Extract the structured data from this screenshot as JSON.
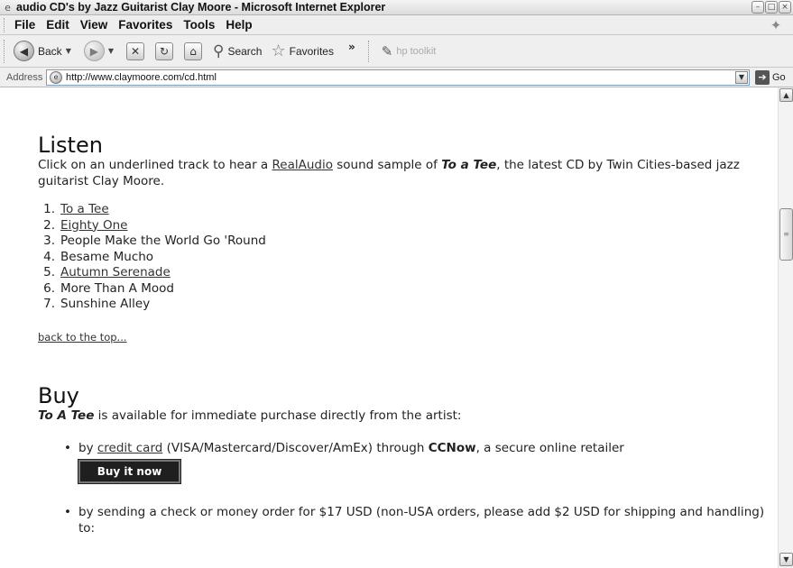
{
  "window": {
    "title": "audio CD's by Jazz Guitarist Clay Moore - Microsoft Internet Explorer",
    "controls": [
      "–",
      "□",
      "×"
    ]
  },
  "menu": [
    "File",
    "Edit",
    "View",
    "Favorites",
    "Tools",
    "Help"
  ],
  "toolbar": {
    "back_label": "Back",
    "search_label": "Search",
    "favorites_label": "Favorites",
    "more": "»",
    "hp_label": "hp toolkit"
  },
  "address": {
    "label": "Address",
    "url": "http://www.claymoore.com/cd.html",
    "go_label": "Go"
  },
  "listen": {
    "heading": "Listen",
    "intro_1": "Click on an underlined track to hear a ",
    "realaudio_link": "RealAudio",
    "intro_2": " sound sample of ",
    "album_title": "To a Tee",
    "intro_3": ", the latest CD by Twin Cities-based jazz guitarist Clay Moore.",
    "tracks": [
      {
        "num": "1.",
        "title": "To a Tee",
        "linked": true
      },
      {
        "num": "2.",
        "title": "Eighty One",
        "linked": true
      },
      {
        "num": "3.",
        "title": "People Make the World Go 'Round",
        "linked": false
      },
      {
        "num": "4.",
        "title": "Besame Mucho",
        "linked": false
      },
      {
        "num": "5.",
        "title": "Autumn Serenade",
        "linked": true
      },
      {
        "num": "6.",
        "title": "More Than A Mood",
        "linked": false
      },
      {
        "num": "7.",
        "title": "Sunshine Alley",
        "linked": false
      }
    ],
    "back_to_top": "back to the top..."
  },
  "buy": {
    "heading": "Buy",
    "album_title": "To A Tee",
    "intro": " is available for immediate purchase directly from the artist:",
    "option1_pre": "by ",
    "option1_link": "credit card",
    "option1_mid": " (VISA/Mastercard/Discover/AmEx) through ",
    "option1_vendor": "CCNow",
    "option1_post": ", a secure online retailer",
    "buy_button": "Buy it now",
    "option2": "by sending a check or money order for $17 USD (non-USA orders, please add $2 USD for shipping and handling) to:"
  },
  "scrollbar": {
    "up": "▲",
    "down": "▼",
    "grip": "≡",
    "position": 0.25
  }
}
